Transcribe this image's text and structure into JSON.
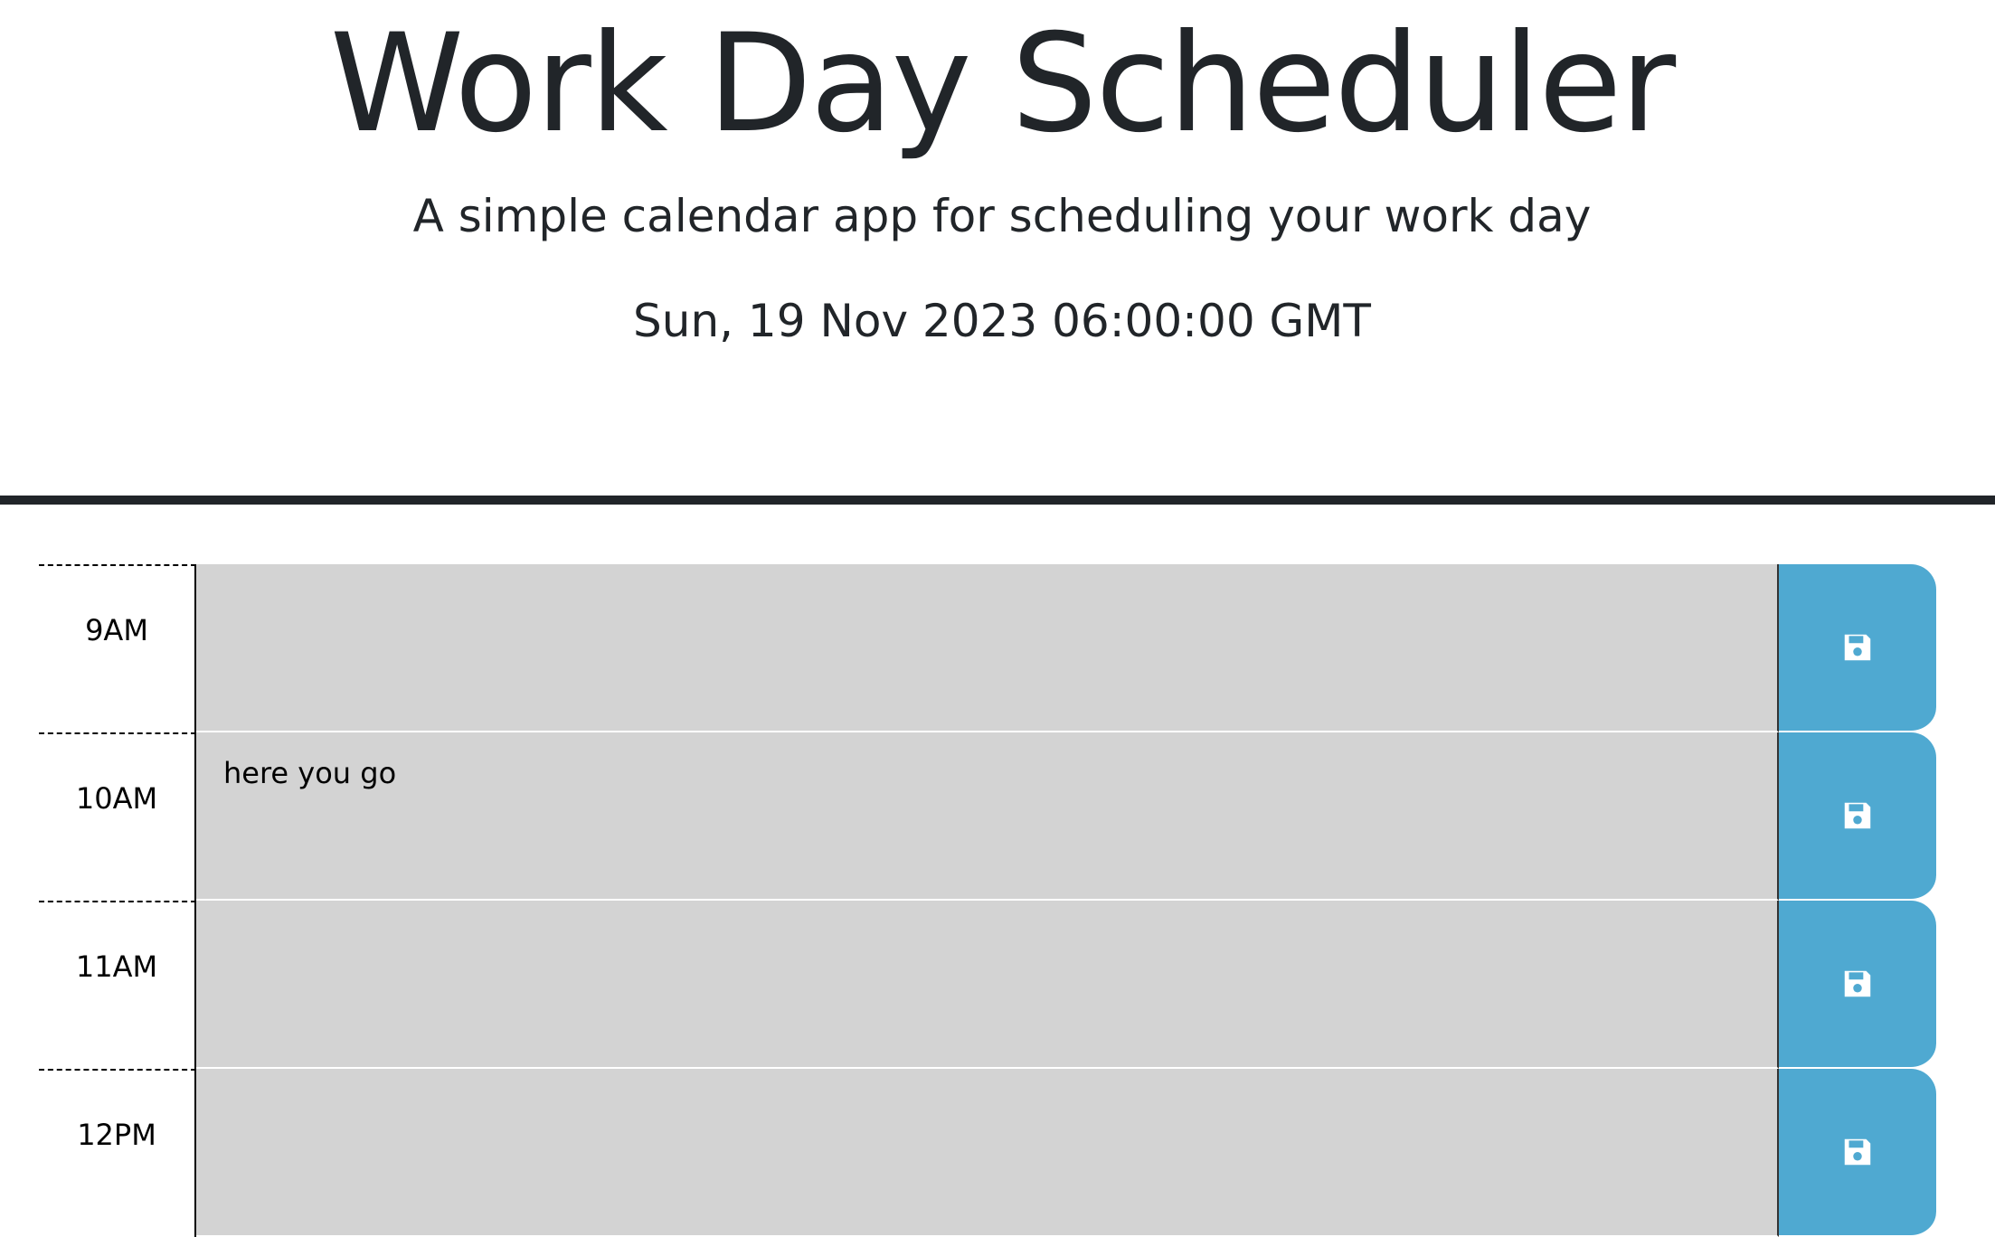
{
  "header": {
    "title": "Work Day Scheduler",
    "subtitle": "A simple calendar app for scheduling your work day",
    "current_day": "Sun, 19 Nov 2023 06:00:00 GMT"
  },
  "colors": {
    "text": "#212529",
    "description_bg": "#d3d3d3",
    "save_button": "#4fa9d1",
    "divider": "#212529"
  },
  "time_blocks": [
    {
      "hour": "9AM",
      "text": "",
      "save_icon": "floppy-disk-icon"
    },
    {
      "hour": "10AM",
      "text": "here you go",
      "save_icon": "floppy-disk-icon"
    },
    {
      "hour": "11AM",
      "text": "",
      "save_icon": "floppy-disk-icon"
    },
    {
      "hour": "12PM",
      "text": "",
      "save_icon": "floppy-disk-icon"
    }
  ]
}
